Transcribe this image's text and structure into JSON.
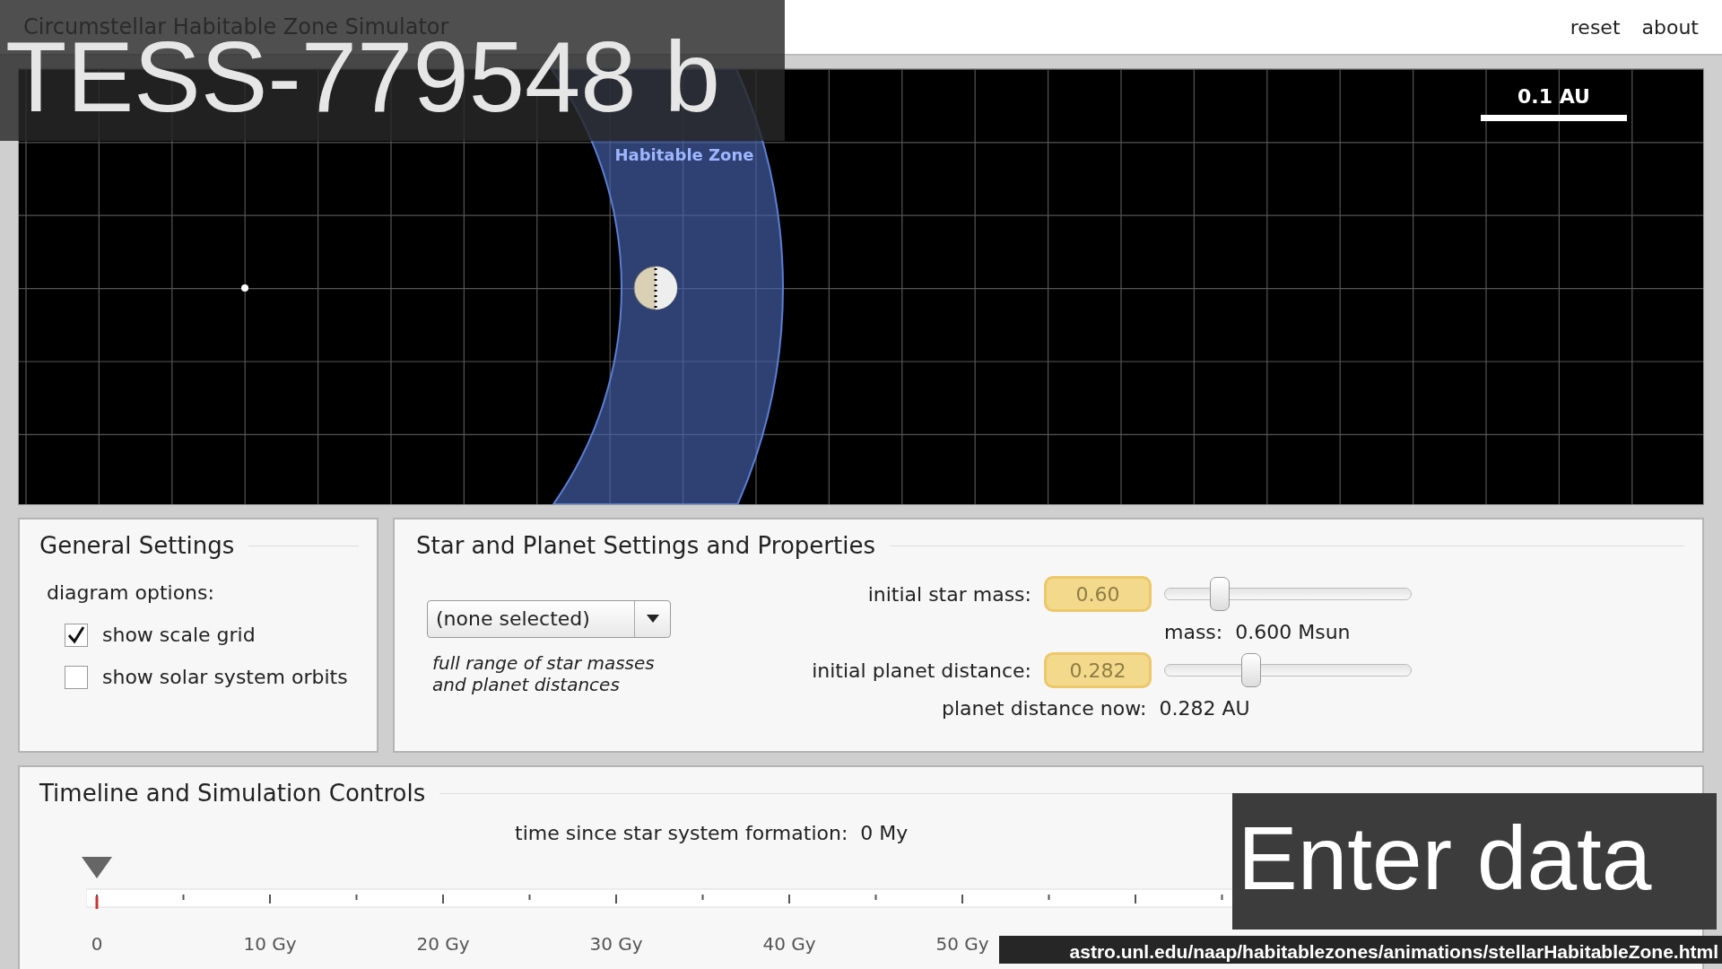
{
  "header": {
    "title": "Circumstellar Habitable Zone Simulator",
    "links": [
      "reset",
      "about"
    ]
  },
  "diagram": {
    "scale_label": "0.1 AU",
    "zone_label": "Habitable Zone"
  },
  "general": {
    "title": "General Settings",
    "subtitle": "diagram options:",
    "options": [
      {
        "label": "show scale grid",
        "checked": true
      },
      {
        "label": "show solar system orbits",
        "checked": false
      }
    ]
  },
  "star_planet": {
    "title": "Star and Planet Settings and Properties",
    "preset": "(none selected)",
    "preset_note": "full range of star masses and planet distances",
    "fields": [
      {
        "label": "initial star mass:",
        "value": "0.60",
        "level": 0.2,
        "reading": "mass:  0.600 Msun"
      },
      {
        "label": "initial planet distance:",
        "value": "0.282",
        "level": 0.34,
        "reading": "planet distance now:  0.282 AU"
      }
    ]
  },
  "timeline": {
    "title": "Timeline and Simulation Controls",
    "time_label": "time since star system formation:  0 My",
    "level": 0,
    "ticks": [
      "0",
      "10 Gy",
      "20 Gy",
      "30 Gy",
      "40 Gy",
      "50 Gy"
    ]
  },
  "overlays": {
    "caption": "TESS-779548 b",
    "label": "Enter data",
    "url": "astro.unl.edu/naap/habitablezones/animations/stellarHabitableZone.html"
  }
}
